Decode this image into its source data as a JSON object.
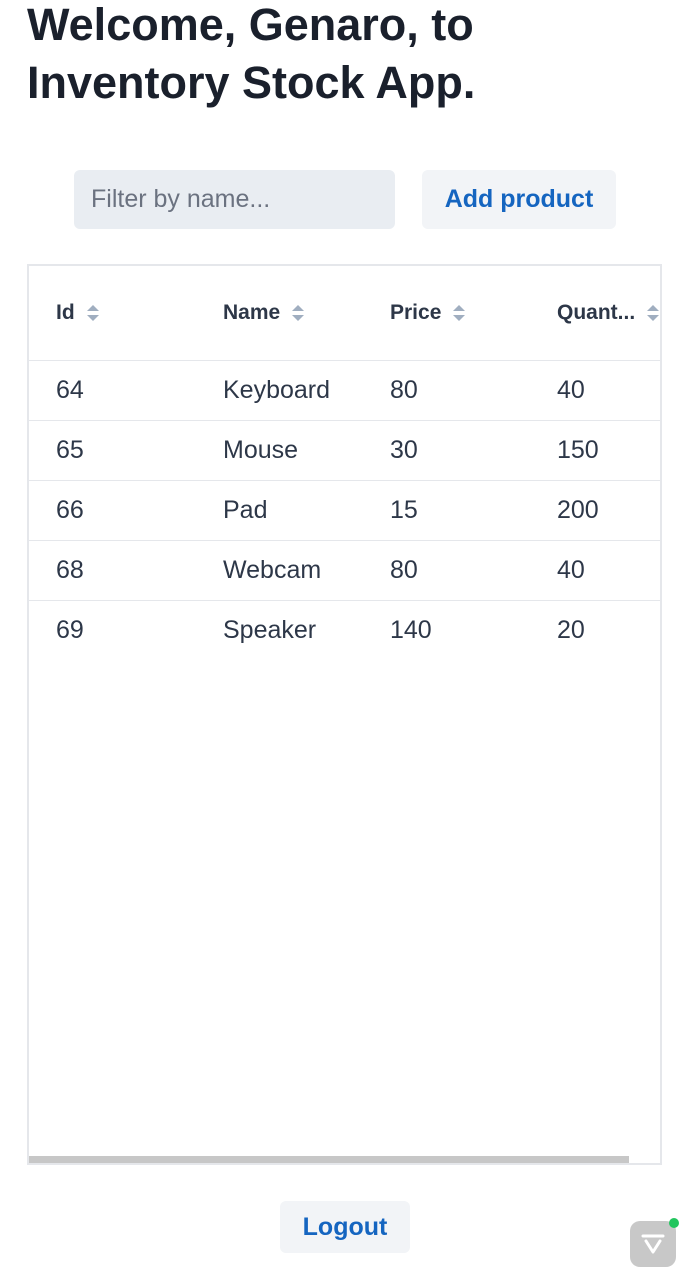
{
  "header": {
    "title_line1": "Welcome, Genaro, to",
    "title_line2": "Inventory Stock App."
  },
  "toolbar": {
    "filter_placeholder": "Filter by name...",
    "filter_value": "",
    "add_label": "Add product"
  },
  "table": {
    "columns": [
      "Id",
      "Name",
      "Price",
      "Quant..."
    ],
    "rows": [
      [
        "64",
        "Keyboard",
        "80",
        "40"
      ],
      [
        "65",
        "Mouse",
        "30",
        "150"
      ],
      [
        "66",
        "Pad",
        "15",
        "200"
      ],
      [
        "68",
        "Webcam",
        "80",
        "40"
      ],
      [
        "69",
        "Speaker",
        "140",
        "20"
      ]
    ]
  },
  "footer": {
    "logout_label": "Logout"
  },
  "colors": {
    "accent": "#1565c0",
    "input_bg": "#e9edf2",
    "button_bg": "#f2f4f7",
    "status_dot": "#22c55e"
  },
  "icons": {
    "sort": "sort-arrows-icon",
    "floating_badge": "chevron-down-badge-icon"
  }
}
